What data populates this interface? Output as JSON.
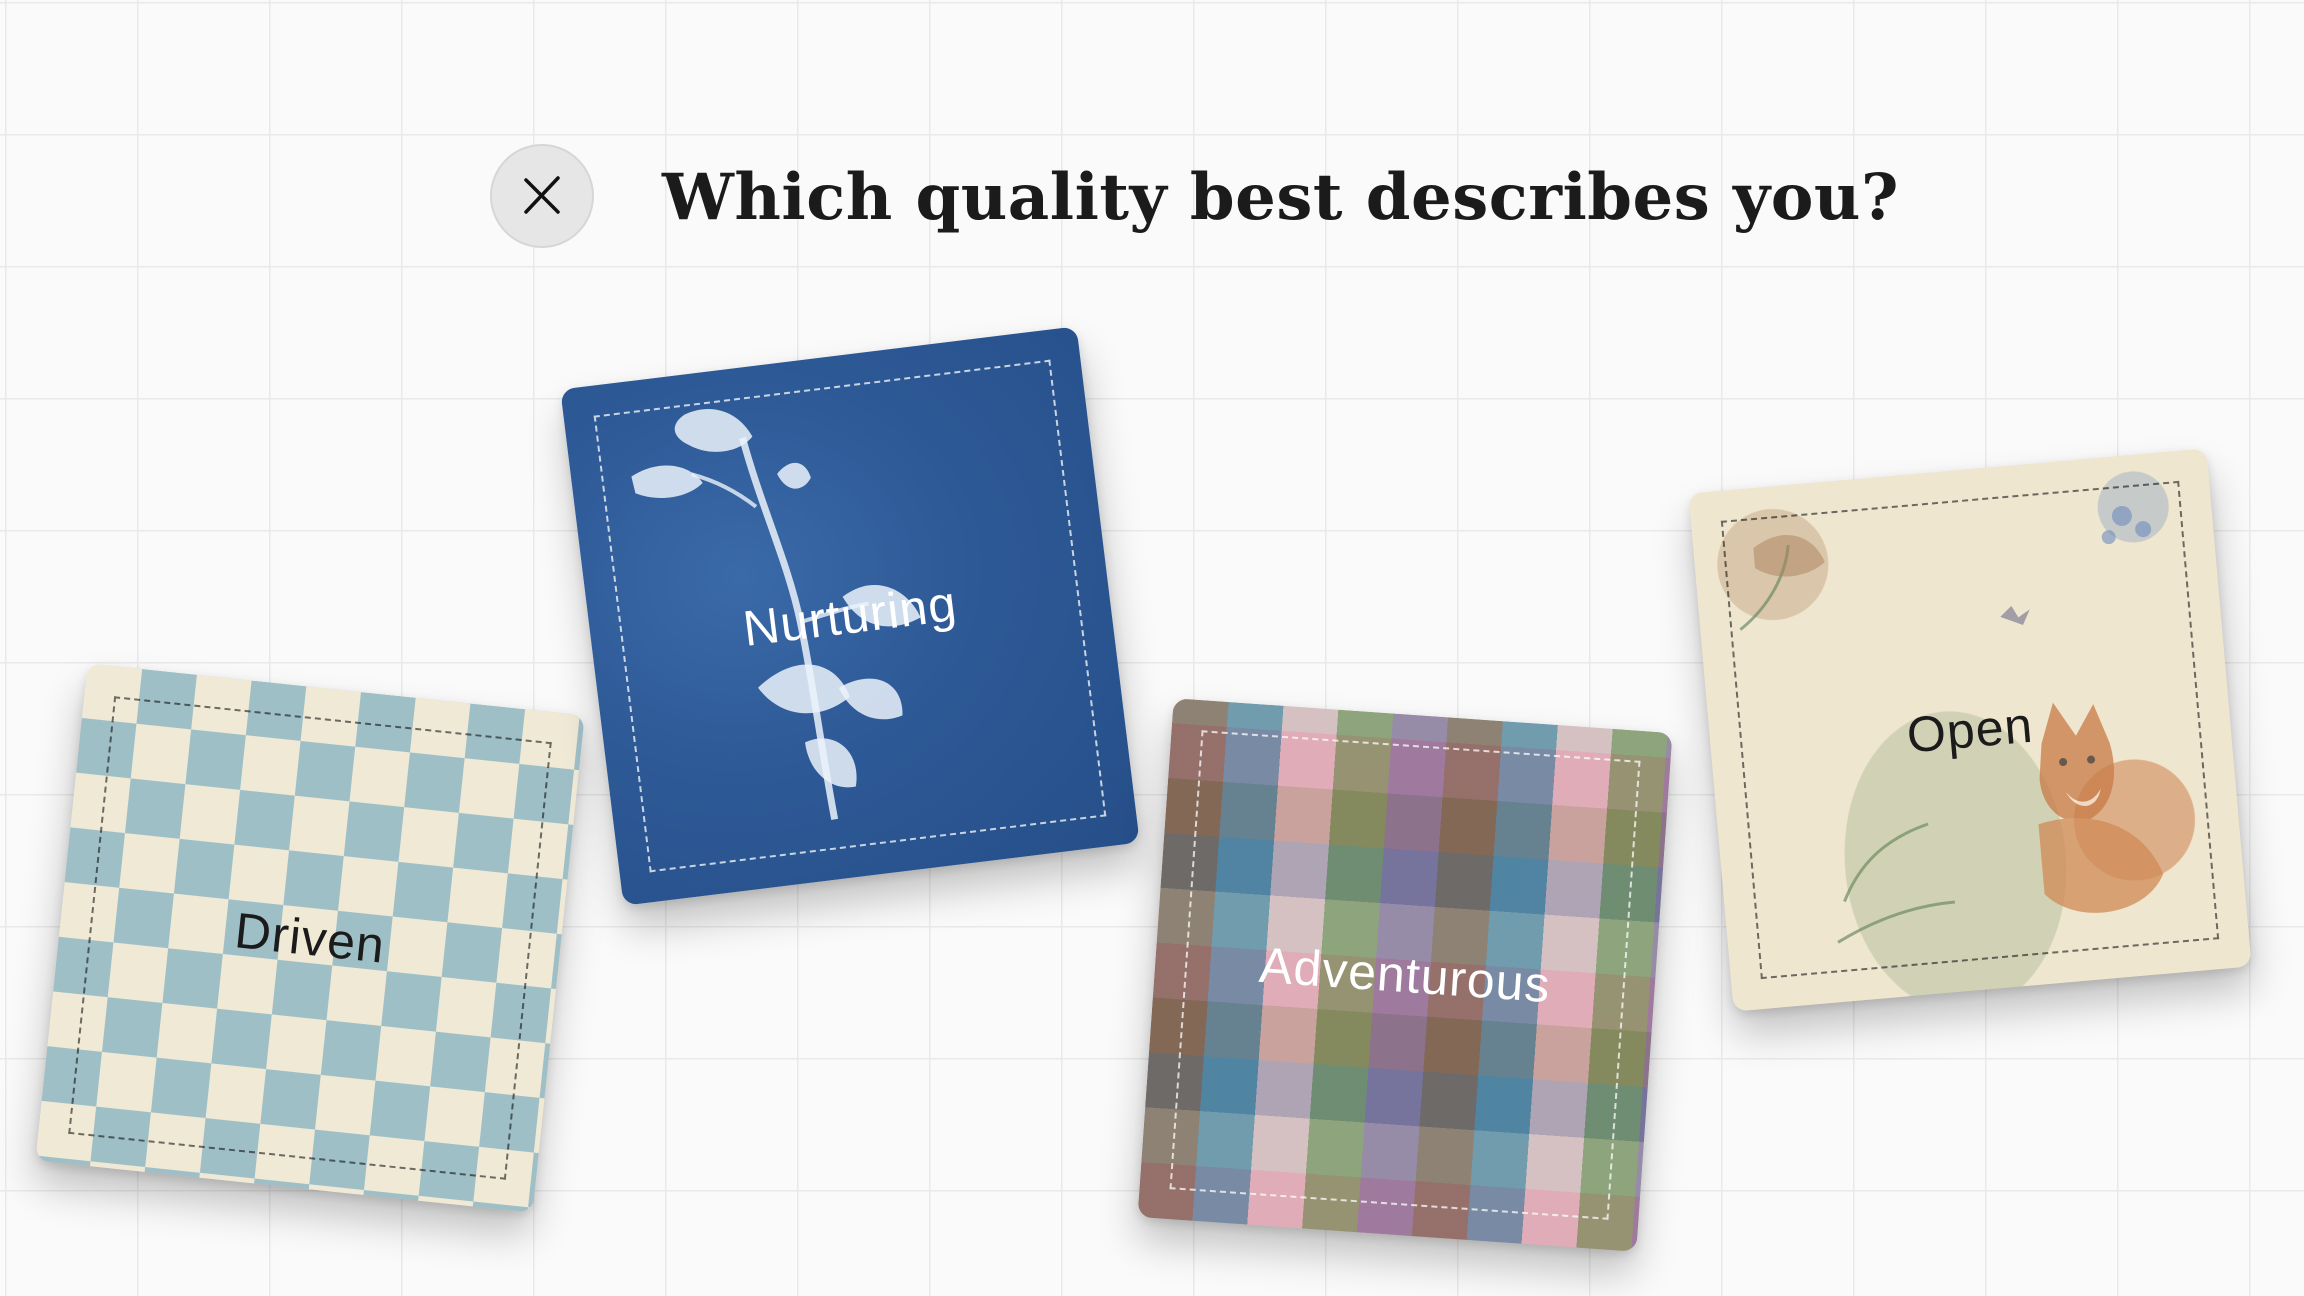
{
  "header": {
    "title": "Which quality best describes you?",
    "close_icon": "close-icon"
  },
  "options": [
    {
      "label": "Driven",
      "pattern": "wavy-checker",
      "colors": [
        "#9fbfc7",
        "#efe9d6"
      ]
    },
    {
      "label": "Nurturing",
      "pattern": "cyanotype-botanical",
      "colors": [
        "#2d5996",
        "#ffffff"
      ]
    },
    {
      "label": "Adventurous",
      "pattern": "plaid",
      "colors": [
        "#e6a0b4",
        "#3a78a0",
        "#5f7d3c",
        "#6e508c"
      ]
    },
    {
      "label": "Open",
      "pattern": "watercolor-fox",
      "colors": [
        "#efe6cf",
        "#cd8250"
      ]
    }
  ]
}
